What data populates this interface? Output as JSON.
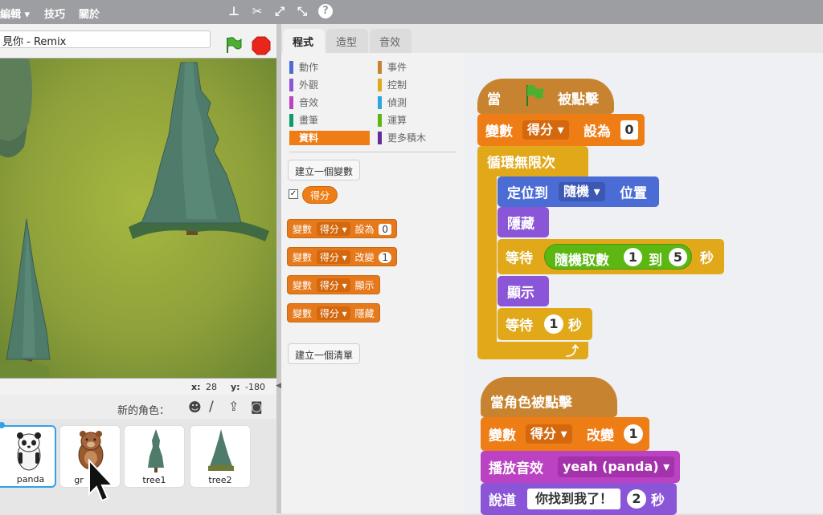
{
  "menubar": {
    "edit": "編輯 ▾",
    "tips": "技巧",
    "about": "關於"
  },
  "project": {
    "title": "見你 - Remix"
  },
  "stage": {
    "coord_x_label": "x:",
    "coord_x": "28",
    "coord_y_label": "y:",
    "coord_y": "-180"
  },
  "sprite_bar": {
    "new_sprite_label": "新的角色："
  },
  "sprites": [
    {
      "name": "panda"
    },
    {
      "name": "gr"
    },
    {
      "name": "tree1"
    },
    {
      "name": "tree2"
    }
  ],
  "tabs": [
    {
      "label": "程式"
    },
    {
      "label": "造型"
    },
    {
      "label": "音效"
    }
  ],
  "palette": {
    "categories_left": [
      {
        "label": "動作",
        "color": "#4a6cd4"
      },
      {
        "label": "外觀",
        "color": "#8a55d7"
      },
      {
        "label": "音效",
        "color": "#bb42c3"
      },
      {
        "label": "畫筆",
        "color": "#0e9a6c"
      },
      {
        "label": "資料",
        "color": "#ee7d16"
      }
    ],
    "categories_right": [
      {
        "label": "事件",
        "color": "#c88330"
      },
      {
        "label": "控制",
        "color": "#e1a91a"
      },
      {
        "label": "偵測",
        "color": "#2ca5e2"
      },
      {
        "label": "運算",
        "color": "#5cb712"
      },
      {
        "label": "更多積木",
        "color": "#632d99"
      }
    ],
    "make_variable": "建立一個變數",
    "variable_name": "得分",
    "blocks": [
      {
        "kw": "變數",
        "var": "得分",
        "op": "設為",
        "val": "0"
      },
      {
        "kw": "變數",
        "var": "得分",
        "op": "改變",
        "val": "1"
      },
      {
        "kw": "變數",
        "var": "得分",
        "op": "顯示",
        "val": ""
      },
      {
        "kw": "變數",
        "var": "得分",
        "op": "隱藏",
        "val": ""
      }
    ],
    "make_list": "建立一個清單"
  },
  "script1": {
    "hat_prefix": "當",
    "hat_suffix": "被點擊",
    "set_kw": "變數",
    "set_var": "得分",
    "set_op": "設為",
    "set_val": "0",
    "forever": "循環無限次",
    "goto_kw": "定位到",
    "goto_target": "隨機",
    "goto_suffix": "位置",
    "hide": "隱藏",
    "wait1_kw": "等待",
    "random_kw": "隨機取數",
    "random_from": "1",
    "random_to_kw": "到",
    "random_to": "5",
    "wait1_suffix": "秒",
    "show": "顯示",
    "wait2_kw": "等待",
    "wait2_val": "1",
    "wait2_suffix": "秒"
  },
  "script2": {
    "hat": "當角色被點擊",
    "change_kw": "變數",
    "change_var": "得分",
    "change_op": "改變",
    "change_val": "1",
    "sound_kw": "播放音效",
    "sound_name": "yeah (panda)",
    "say_kw": "說道",
    "say_text": "你找到我了！",
    "say_val": "2",
    "say_suffix": "秒"
  },
  "colors": {
    "data": "#ee7d16",
    "events": "#c88330",
    "control": "#e1a91a",
    "motion": "#4a6cd4",
    "looks": "#8a55d7",
    "operators": "#5cb712",
    "sound": "#bb42c3"
  }
}
